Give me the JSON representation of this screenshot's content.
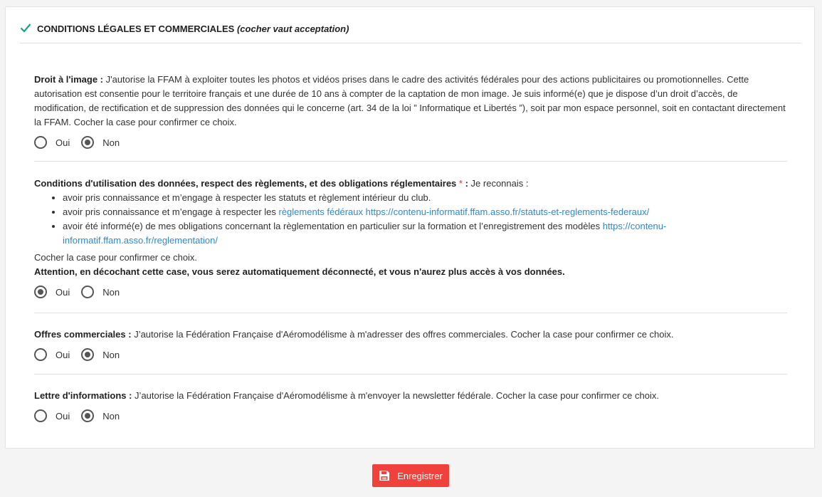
{
  "header": {
    "title": "CONDITIONS LÉGALES ET COMMERCIALES",
    "subtitle": "(cocher vaut acceptation)"
  },
  "image_rights": {
    "label": "Droit à l'image :",
    "text": " J'autorise la FFAM à exploiter toutes les photos et vidéos prises dans le cadre des activités fédérales pour des actions publicitaires ou promotionnelles. Cette autorisation est consentie pour le territoire français et une durée de 10 ans à compter de la captation de mon image. Je suis informé(e) que je dispose d’un droit d’accès, de modification, de rectification et de suppression des données qui le concerne (art. 34 de la loi ” Informatique et Libertés ”), soit par mon espace personnel, soit en contactant directement la FFAM. Cocher la case pour confirmer ce choix.",
    "yes": "Oui",
    "no": "Non",
    "selected": "no"
  },
  "conditions": {
    "label": "Conditions d'utilisation des données, respect des règlements, et des obligations réglementaires",
    "required": "*",
    "colon": " :",
    "intro": " Je reconnais :",
    "item1": "avoir pris connaissance et m’engage à respecter les statuts et règlement intérieur du club.",
    "item2_text": "avoir pris connaissance et m’engage à respecter les ",
    "item2_link1": "règlements fédéraux",
    "item2_link2": "https://contenu-informatif.ffam.asso.fr/statuts-et-reglements-federaux/",
    "item3_text": "avoir été informé(e) de mes obligations concernant la règlementation en particulier sur la formation et l’enregistrement des modèles ",
    "item3_link": "https://contenu-informatif.ffam.asso.fr/reglementation/",
    "confirm": "Cocher la case pour confirmer ce choix.",
    "warning": "Attention, en décochant cette case, vous serez automatiquement déconnecté, et vous n'aurez plus accès à vos données.",
    "yes": "Oui",
    "no": "Non",
    "selected": "yes"
  },
  "offers": {
    "label": "Offres commerciales :",
    "text": " J’autorise la Fédération Française d'Aéromodélisme à m'adresser des offres commerciales. Cocher la case pour confirmer ce choix.",
    "yes": "Oui",
    "no": "Non",
    "selected": "no"
  },
  "newsletter": {
    "label": "Lettre d'informations :",
    "text": " J’autorise la Fédération Française d'Aéromodélisme à m'envoyer la newsletter fédérale. Cocher la case pour confirmer ce choix.",
    "yes": "Oui",
    "no": "Non",
    "selected": "no"
  },
  "save_button": {
    "label": "Enregistrer"
  },
  "colors": {
    "accent": "#1aa087",
    "button": "#f0413c",
    "link": "#2a8bd1"
  },
  "icons": {
    "header": "check-icon",
    "save": "floppy-disk-icon"
  }
}
